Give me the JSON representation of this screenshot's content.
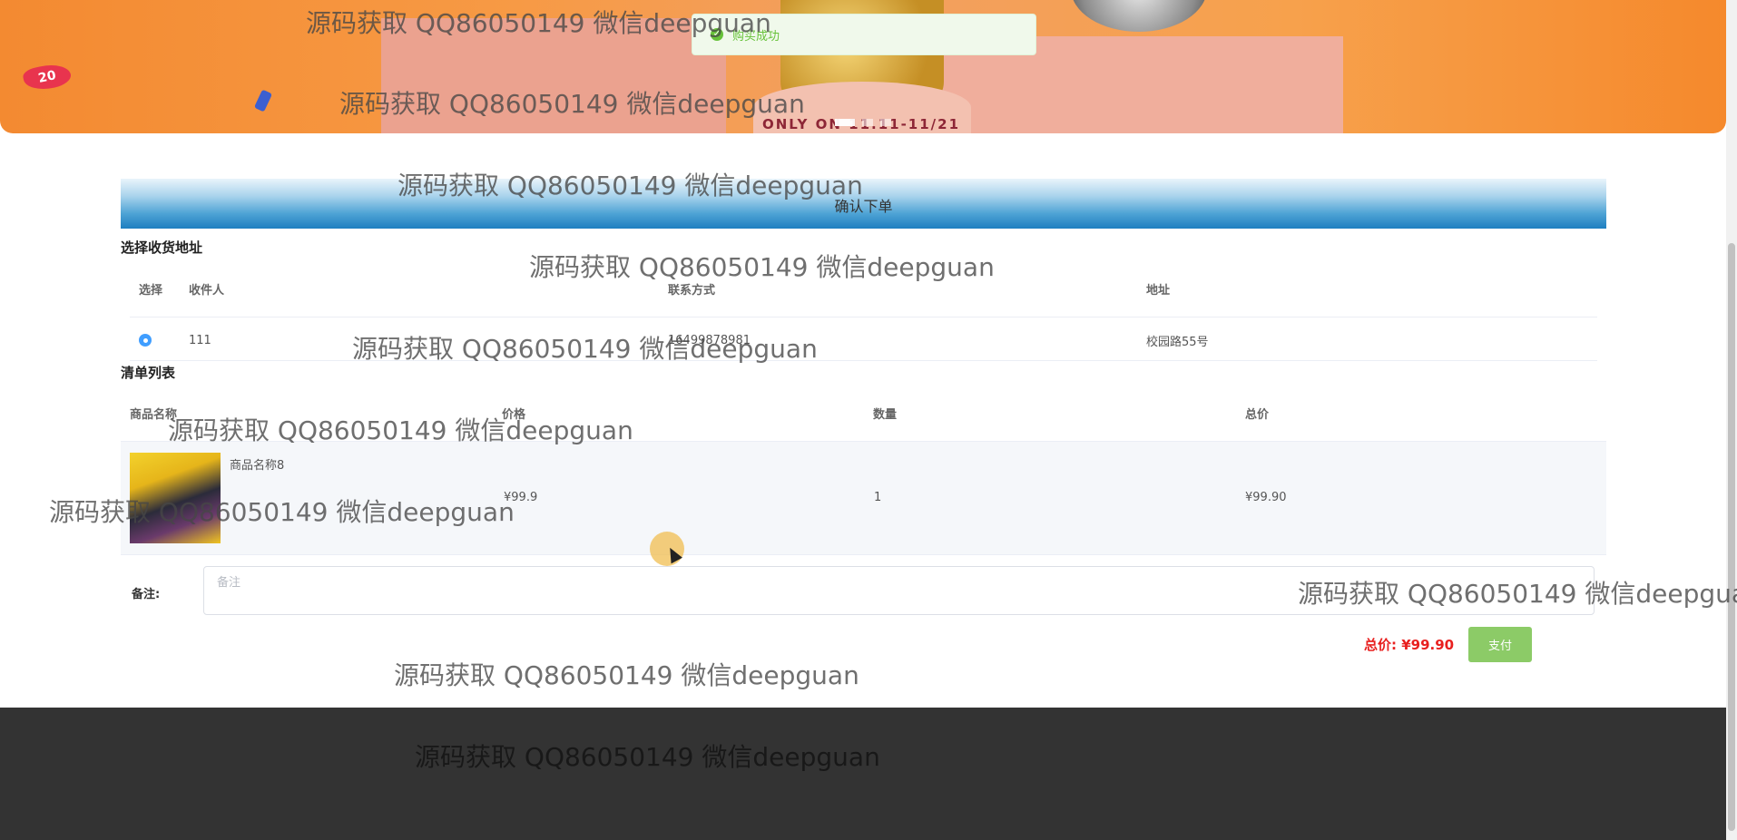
{
  "toast": {
    "message": "购买成功"
  },
  "banner": {
    "badge": "20",
    "text": "ONLY ON 11.11-11/21"
  },
  "confirm": {
    "title": "确认下单"
  },
  "address": {
    "section_title": "选择收货地址",
    "columns": [
      "选择",
      "收件人",
      "联系方式",
      "地址"
    ],
    "rows": [
      {
        "selected": true,
        "name": "111",
        "phone": "16499878981",
        "address": "校园路55号"
      }
    ]
  },
  "goods": {
    "section_title": "清单列表",
    "columns": [
      "商品名称",
      "价格",
      "数量",
      "总价"
    ],
    "rows": [
      {
        "name": "商品名称8",
        "price": "¥99.9",
        "quantity": "1",
        "total": "¥99.90"
      }
    ]
  },
  "remark": {
    "label": "备注:",
    "placeholder": "备注"
  },
  "summary": {
    "total_label": "总价:",
    "total_value": "¥99.90",
    "pay_label": "支付"
  },
  "watermark": "源码获取 QQ86050149 微信deepguan",
  "colors": {
    "accent_blue": "#409eff",
    "pay_green": "#8ccb67",
    "total_red": "#e8201f",
    "success_green": "#67c23a",
    "footer": "#333333"
  }
}
